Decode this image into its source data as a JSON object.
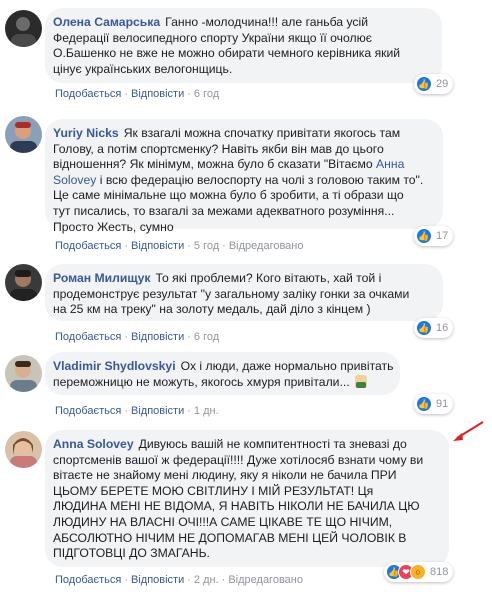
{
  "colors": {
    "author": "#385898",
    "bubble": "#f2f3f5",
    "meta": "#90949c",
    "like": "#1877f2",
    "love": "#f33e58",
    "wow": "#f7b125",
    "arrow": "#e02020"
  },
  "comments": [
    {
      "author": "Олена Самарська",
      "text_lines": [
        "Ганно -молодчина!!! але ганьба усій",
        "Федерації велосипедного спорту України якщо її очолює",
        "О.Башенко не вже не можно обирати чемного керівника який",
        "цінує українських велогонщиць."
      ],
      "actions": [
        "Подобається",
        "Відповісти"
      ],
      "time": "6 год",
      "reaction_icons": [
        "like-icon"
      ],
      "reaction_count": "29"
    },
    {
      "author": "Yuriy Nicks",
      "text_lines": [
        "Як взагалі можна спочатку привітати якогось там",
        "Голову, а потім спортсменку? Навіть якби він мав до цього",
        "відношення? Як мінімум, можна було б сказати \"Вітаємо Анна",
        "Solovey і всю федерацію велоспорту на чолі з головою таким то\".",
        "Це саме мінімальне що можна було б зробити, а ті образи що",
        "тут писались, то взагалі за межами адекватного розуміння...",
        "Просто Жесть, сумно"
      ],
      "actions": [
        "Подобається",
        "Відповісти"
      ],
      "time": "5 год",
      "edited": "Відредаговано",
      "reaction_icons": [
        "like-icon"
      ],
      "reaction_count": "17"
    },
    {
      "author": "Роман Милищук",
      "text_lines": [
        "То які проблеми? Кого вітають, хай той і",
        "продемонструє результат \"у загальному заліку гонки за очками",
        "на 25 км на треку\" на золоту медаль, дай діло з кінцем )"
      ],
      "actions": [
        "Подобається",
        "Відповісти"
      ],
      "time": "6 год",
      "reaction_icons": [
        "like-icon"
      ],
      "reaction_count": "16"
    },
    {
      "author": "Vladimir Shydlovskyi",
      "text_lines": [
        "Ох і люди, даже нормально привітать",
        "переможницю не можуть, якогось хмуря привітали..."
      ],
      "actions": [
        "Подобається",
        "Відповісти"
      ],
      "time": "1 дн.",
      "reaction_icons": [
        "like-icon"
      ],
      "reaction_count": "91"
    },
    {
      "author": "Anna Solovey",
      "text_lines": [
        "Дивуюсь вашій не компитентності та зневазі до",
        "спортсменів вашої ж федерації!!!! Дуже хотілосяб взнати чому ви",
        "вітаєте не знайому мені людину, яку я ніколи не бачила ПРИ",
        "ЦЬОМУ БЕРЕТЕ МОЮ СВІТЛИНУ І МІЙ РЕЗУЛЬТАТ! Ця",
        "ЛЮДИНА МЕНІ НЕ ВІДОМА, Я НАВІТЬ НІКОЛИ НЕ БАЧИЛА ЦЮ",
        "ЛЮДИНУ НА ВЛАСНІ ОЧІ!!!А САМЕ ЦІКАВЕ ТЕ ЩО НІЧИМ,",
        "АБСОЛЮТНО НІЧИМ НЕ ДОПОМАГАВ МЕНІ ЦЕЙ ЧОЛОВІК В",
        "ПІДГОТОВЦІ ДО ЗМАГАНЬ."
      ],
      "actions": [
        "Подобається",
        "Відповісти"
      ],
      "time": "2 дн.",
      "edited": "Відредаговано",
      "reaction_icons": [
        "like-icon",
        "love-icon",
        "wow-icon"
      ],
      "reaction_count": "818"
    }
  ]
}
